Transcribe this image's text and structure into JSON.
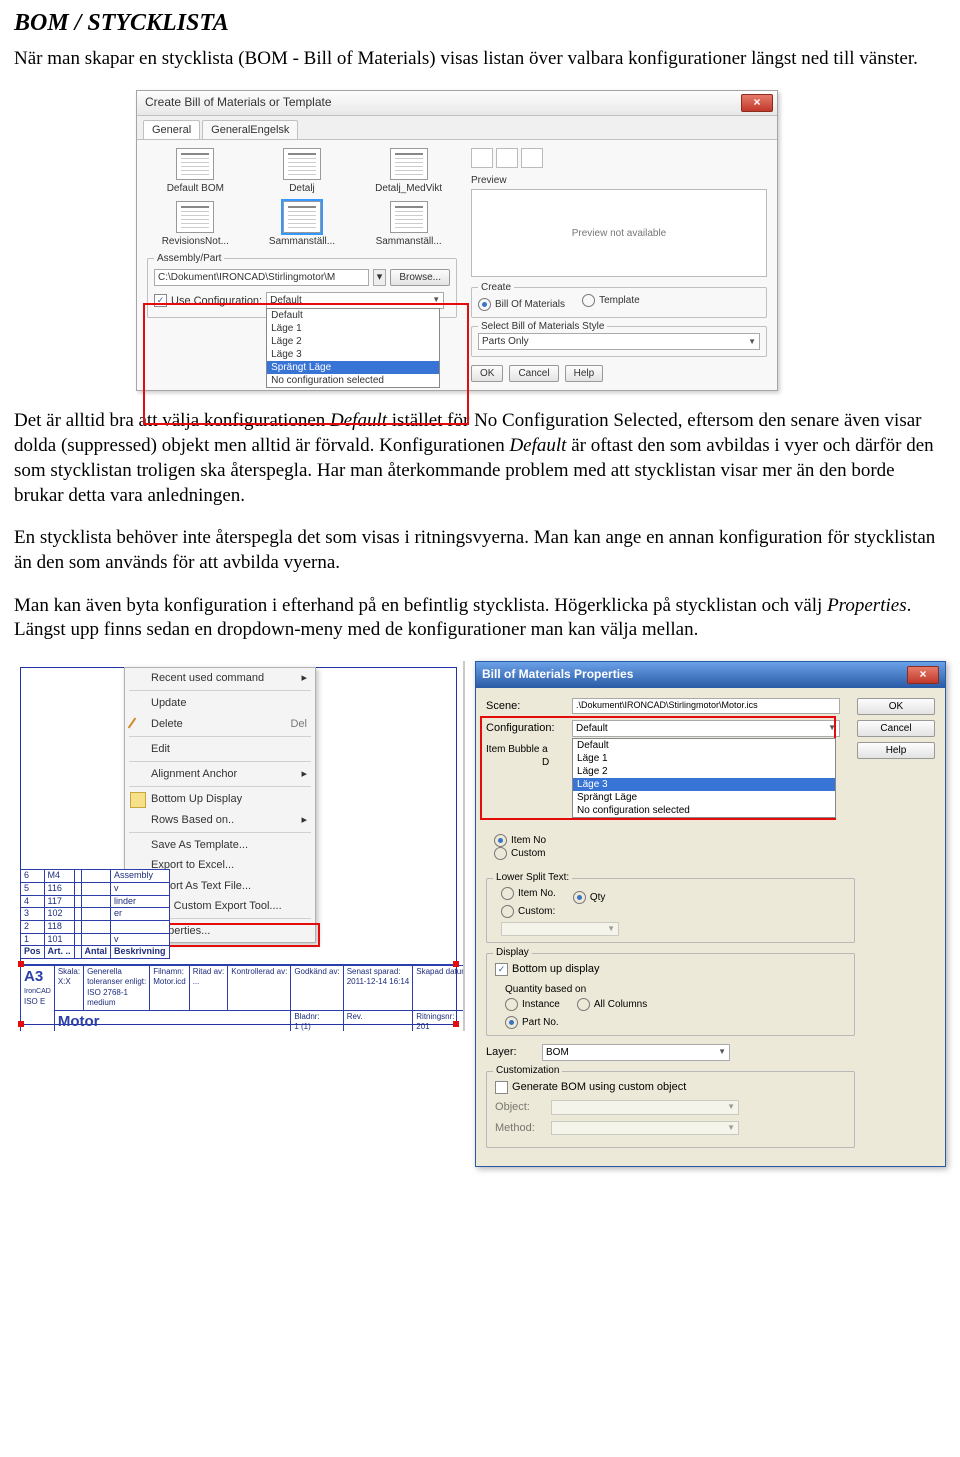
{
  "heading": "BOM / STYCKLISTA",
  "intro": "När man skapar en stycklista (BOM - Bill of Materials) visas listan över valbara konfigurationer längst ned till vänster.",
  "para2_a": "Det är alltid bra att välja konfigurationen ",
  "para2_def1": "Default",
  "para2_b": " istället för No Configuration Selected, eftersom den senare även visar dolda (suppressed) objekt men alltid är förvald. Konfigurationen ",
  "para2_def2": "Default",
  "para2_c": " är oftast den som avbildas i vyer och därför den som stycklistan troligen ska återspegla. Har man återkommande problem med att stycklistan visar mer än den borde brukar detta vara anledningen.",
  "para3": "En stycklista behöver inte återspegla det som visas i ritningsvyerna. Man kan ange en annan konfiguration för stycklistan än den som används för att avbilda vyerna.",
  "para4_a": "Man kan även byta konfiguration i efterhand på en befintlig stycklista. Högerklicka på stycklistan och välj ",
  "para4_prop": "Properties",
  "para4_b": ". Längst upp finns sedan en dropdown-meny med de konfigurationer man kan välja mellan.",
  "dlg1": {
    "title": "Create Bill of Materials or Template",
    "close": "×",
    "tabs": [
      "General",
      "GeneralEngelsk"
    ],
    "activeTab": 0,
    "templates": [
      "Default BOM",
      "Detalj",
      "Detalj_MedVikt",
      "RevisionsNot...",
      "Sammanställ...",
      "Sammanställ..."
    ],
    "selectedTemplate": 4,
    "assemblyCaption": "Assembly/Part",
    "path": "C:\\Dokument\\IRONCAD\\Stirlingmotor\\M",
    "browse": "Browse...",
    "useCfg": "Use Configuration:",
    "cfgValue": "Default",
    "cfgOptions": [
      "Default",
      "Läge 1",
      "Läge 2",
      "Läge 3",
      "Sprängt Läge",
      "No configuration selected"
    ],
    "cfgSelectedIdx": 4,
    "previewHdr": "Preview",
    "previewText": "Preview not available",
    "createHdr": "Create",
    "radioBOM": "Bill Of Materials",
    "radioTpl": "Template",
    "styleHdr": "Select Bill of Materials Style",
    "styleValue": "Parts Only",
    "ok": "OK",
    "cancel": "Cancel",
    "help": "Help"
  },
  "menu": {
    "items": [
      "Recent used command",
      "Update",
      "Delete",
      "Edit",
      "Alignment Anchor",
      "Bottom Up Display",
      "Rows Based on..",
      "Save As Template...",
      "Export to Excel...",
      "Export  As Text File...",
      "Add Custom Export Tool....",
      "Properties..."
    ],
    "shortDel": "Del"
  },
  "bom": {
    "rows": [
      [
        "6",
        "M4",
        "",
        "",
        "Assembly"
      ],
      [
        "5",
        "116",
        "",
        "",
        "v"
      ],
      [
        "4",
        "117",
        "",
        "",
        "linder"
      ],
      [
        "3",
        "102",
        "",
        "",
        "er"
      ],
      [
        "2",
        "118",
        "",
        "",
        ""
      ],
      [
        "1",
        "101",
        "",
        "",
        "v"
      ]
    ],
    "hdr": [
      "Pos",
      "Art. ..",
      "",
      "Antal",
      "Beskrivning"
    ]
  },
  "titleblock": {
    "a3": "A3",
    "isoE": "ISO E",
    "scale": "Skala:\nX:X",
    "tol": "Generella\ntoleranser enligt:\nISO 2768-1\nmedium",
    "file": "Filnamn:\nMotor.icd",
    "ritad": "Ritad av:\n...",
    "kontr": "Kontrollerad av:",
    "godkand": "Godkänd av:",
    "sparad": "Senast sparad:\n2011-12-14 16:14",
    "skapad": "Skapad datum:",
    "motor": "Motor",
    "bladnr": "Bladnr:\n1 (1)",
    "rev": "Rev.",
    "ritnr": "Ritningsnr:\n201"
  },
  "dlg2": {
    "title": "Bill of Materials Properties",
    "close": "×",
    "scene": "Scene:",
    "sceneVal": ".\\Dokument\\IRONCAD\\Stirlingmotor\\Motor.ics",
    "cfg": "Configuration:",
    "cfgVal": "Default",
    "cfgOptions": [
      "Default",
      "Läge 1",
      "Läge 2",
      "Läge 3",
      "Sprängt Läge",
      "No configuration selected"
    ],
    "cfgSelIdx": 3,
    "itemBub": "Item Bubble a",
    "dPrefix": "D",
    "radItemNo": "Item No",
    "radCustom": "Custom",
    "ok": "OK",
    "cancel": "Cancel",
    "help": "Help",
    "lowerHdr": "Lower Split Text:",
    "lowerItemNo": "Item No.",
    "lowerQty": "Qty",
    "lowerCustom": "Custom:",
    "displayHdr": "Display",
    "bottomUp": "Bottom up display",
    "qtyBased": "Quantity based on",
    "instance": "Instance",
    "allCols": "All Columns",
    "partNo": "Part No.",
    "layer": "Layer:",
    "layerVal": "BOM",
    "custHdr": "Customization",
    "genCustom": "Generate BOM using custom object",
    "object": "Object:",
    "method": "Method:"
  }
}
